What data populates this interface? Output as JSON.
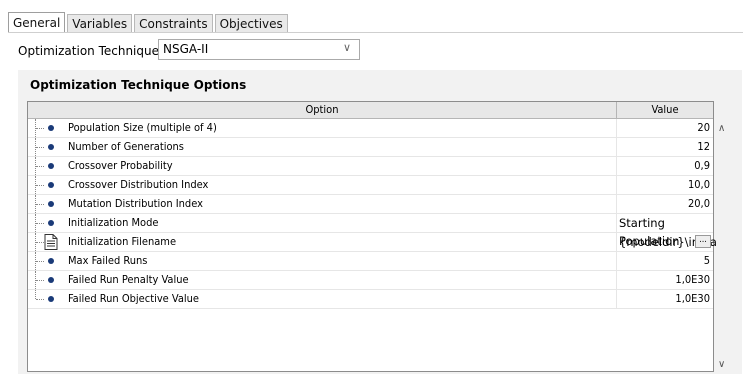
{
  "tabs": [
    {
      "label": "General",
      "active": true
    },
    {
      "label": "Variables",
      "active": false
    },
    {
      "label": "Constraints",
      "active": false
    },
    {
      "label": "Objectives",
      "active": false
    }
  ],
  "technique": {
    "label": "Optimization Technique:",
    "value": "NSGA-II"
  },
  "panel": {
    "title": "Optimization Technique Options"
  },
  "table": {
    "headers": {
      "option": "Option",
      "value": "Value"
    },
    "rows": [
      {
        "option": "Population Size (multiple of 4)",
        "value": "20"
      },
      {
        "option": "Number of Generations",
        "value": "12"
      },
      {
        "option": "Crossover Probability",
        "value": "0,9"
      },
      {
        "option": "Crossover Distribution Index",
        "value": "10,0"
      },
      {
        "option": "Mutation Distribution Index",
        "value": "20,0"
      },
      {
        "option": "Initialization Mode",
        "value": "Starting Population"
      },
      {
        "option": "Initialization Filename",
        "value": "{modeldir}\\initial",
        "button": "..."
      },
      {
        "option": "Max Failed Runs",
        "value": "5"
      },
      {
        "option": "Failed Run Penalty Value",
        "value": "1,0E30"
      },
      {
        "option": "Failed Run Objective Value",
        "value": "1,0E30"
      }
    ]
  },
  "icons": {
    "dropdown": "chevron-down-icon",
    "scroll_up": "scroll-up-icon",
    "scroll_down": "scroll-down-icon",
    "bullet": "bullet-icon",
    "file": "document-icon"
  }
}
